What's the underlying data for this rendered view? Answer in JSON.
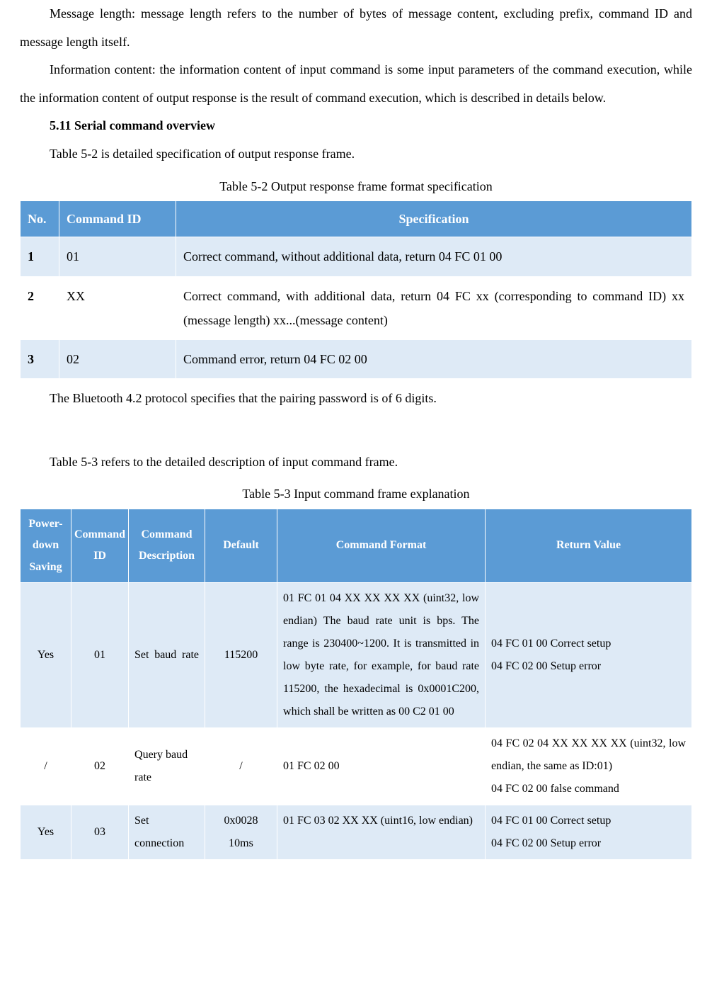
{
  "paragraphs": {
    "p1": "Message length: message length refers to the number of bytes of message content, excluding prefix, command ID and message length itself.",
    "p2": "Information content: the information content of input command is some input parameters of the command execution, while the information content of output response is the result of command execution, which is described in details below.",
    "h511": "5.11 Serial command overview",
    "p3": "Table 5-2 is detailed specification of output response frame.",
    "cap52": "Table 5-2 Output response frame format specification",
    "p4": "The Bluetooth 4.2 protocol specifies that the pairing password is of 6 digits.",
    "p5": "Table 5-3 refers to the detailed description of input command frame.",
    "cap53": "Table 5-3 Input command frame explanation"
  },
  "table52": {
    "headers": {
      "no": "No.",
      "cmd": "Command ID",
      "spec": "Specification"
    },
    "rows": [
      {
        "no": "1",
        "cmd": "01",
        "spec": "Correct command, without additional data, return 04 FC 01 00"
      },
      {
        "no": "2",
        "cmd": "XX",
        "spec": "Correct command, with additional data, return 04 FC xx (corresponding to command ID) xx (message length) xx...(message content)"
      },
      {
        "no": "3",
        "cmd": "02",
        "spec": "Command error, return 04 FC 02 00"
      }
    ]
  },
  "table53": {
    "headers": {
      "pds": "Power-down Saving",
      "cid": "Command ID",
      "desc": "Command Description",
      "def": "Default",
      "fmt": "Command Format",
      "ret": "Return Value"
    },
    "rows": [
      {
        "pds": "Yes",
        "cid": "01",
        "desc": "Set baud rate",
        "def": "115200",
        "fmt": "01 FC 01 04 XX XX XX XX (uint32, low endian)\nThe baud rate unit is bps. The range is 230400~1200. It is transmitted in low byte rate, for example, for baud rate 115200, the hexadecimal is 0x0001C200, which shall be written as 00 C2 01 00",
        "ret": "04 FC 01 00   Correct setup\n04 FC 02 00   Setup error"
      },
      {
        "pds": "/",
        "cid": "02",
        "desc": "Query baud rate",
        "def": "/",
        "fmt": "01 FC 02 00",
        "ret": "04 FC 02 04 XX XX XX XX (uint32, low endian, the same as ID:01)\n04 FC 02 00   false command"
      },
      {
        "pds": "Yes",
        "cid": "03",
        "desc": "Set connection",
        "def": "0x0028\n10ms",
        "fmt": "01 FC 03 02 XX XX (uint16, low endian)",
        "ret": "04 FC 01 00   Correct setup\n04 FC 02 00   Setup error"
      }
    ]
  },
  "chart_data": [
    {
      "type": "table",
      "title": "Table 5-2 Output response frame format specification",
      "columns": [
        "No.",
        "Command ID",
        "Specification"
      ],
      "rows": [
        [
          "1",
          "01",
          "Correct command, without additional data, return 04 FC 01 00"
        ],
        [
          "2",
          "XX",
          "Correct command, with additional data, return 04 FC xx (corresponding to command ID) xx (message length) xx...(message content)"
        ],
        [
          "3",
          "02",
          "Command error, return 04 FC 02 00"
        ]
      ]
    },
    {
      "type": "table",
      "title": "Table 5-3 Input command frame explanation",
      "columns": [
        "Power-down Saving",
        "Command ID",
        "Command Description",
        "Default",
        "Command Format",
        "Return Value"
      ],
      "rows": [
        [
          "Yes",
          "01",
          "Set baud rate",
          "115200",
          "01 FC 01 04 XX XX XX XX (uint32, low endian) The baud rate unit is bps. The range is 230400~1200. It is transmitted in low byte rate, for example, for baud rate 115200, the hexadecimal is 0x0001C200, which shall be written as 00 C2 01 00",
          "04 FC 01 00 Correct setup / 04 FC 02 00 Setup error"
        ],
        [
          "/",
          "02",
          "Query baud rate",
          "/",
          "01 FC 02 00",
          "04 FC 02 04 XX XX XX XX (uint32, low endian, the same as ID:01) / 04 FC 02 00 false command"
        ],
        [
          "Yes",
          "03",
          "Set connection",
          "0x0028 10ms",
          "01 FC 03 02 XX XX (uint16, low endian)",
          "04 FC 01 00 Correct setup / 04 FC 02 00 Setup error"
        ]
      ]
    }
  ]
}
